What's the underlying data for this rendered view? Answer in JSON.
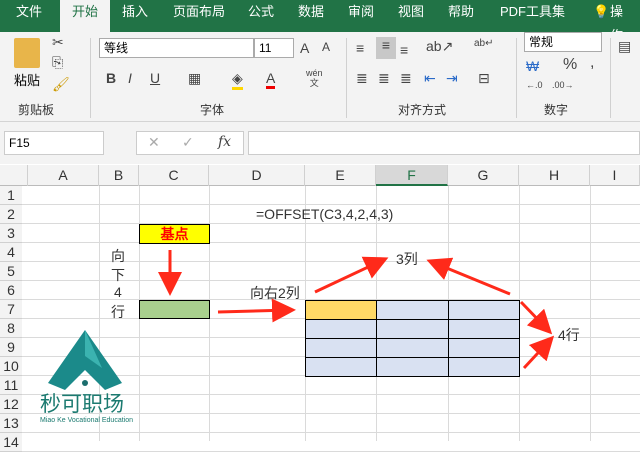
{
  "ribbon": {
    "tabs": [
      "文件",
      "开始",
      "插入",
      "页面布局",
      "公式",
      "数据",
      "审阅",
      "视图",
      "帮助",
      "PDF工具集",
      "操作说"
    ],
    "paste": "粘贴",
    "groups": {
      "clipboard": "剪贴板",
      "font": "字体",
      "align": "对齐方式",
      "number": "数字"
    },
    "font_name": "等线",
    "font_size": "11",
    "number_format": "常规",
    "bold": "B",
    "italic": "I",
    "underline": "U",
    "percent": "%",
    "comma": ",",
    "wen": "wén\n文"
  },
  "formula_bar": {
    "name_box": "F15",
    "fx": "fx",
    "value": ""
  },
  "columns": [
    "A",
    "B",
    "C",
    "D",
    "E",
    "F",
    "G",
    "H",
    "I"
  ],
  "rows": [
    "1",
    "2",
    "3",
    "4",
    "5",
    "6",
    "7",
    "8",
    "9",
    "10",
    "11",
    "12",
    "13",
    "14"
  ],
  "sheet": {
    "formula_text": "=OFFSET(C3,4,2,4,3)",
    "base_label": "基点",
    "down": [
      "向",
      "下",
      "4",
      "行"
    ],
    "right_label": "向右2列",
    "cols_label": "3列",
    "rows_label": "4行"
  },
  "logo": {
    "name": "秒可职场",
    "sub": "Miao Ke Vocational Education"
  },
  "colors": {
    "green": "#217346",
    "base": "#ffff00",
    "start": "#a9d08e",
    "target_first": "#ffd966",
    "target": "#d9e1f2",
    "arrow": "#ff2a1a"
  }
}
